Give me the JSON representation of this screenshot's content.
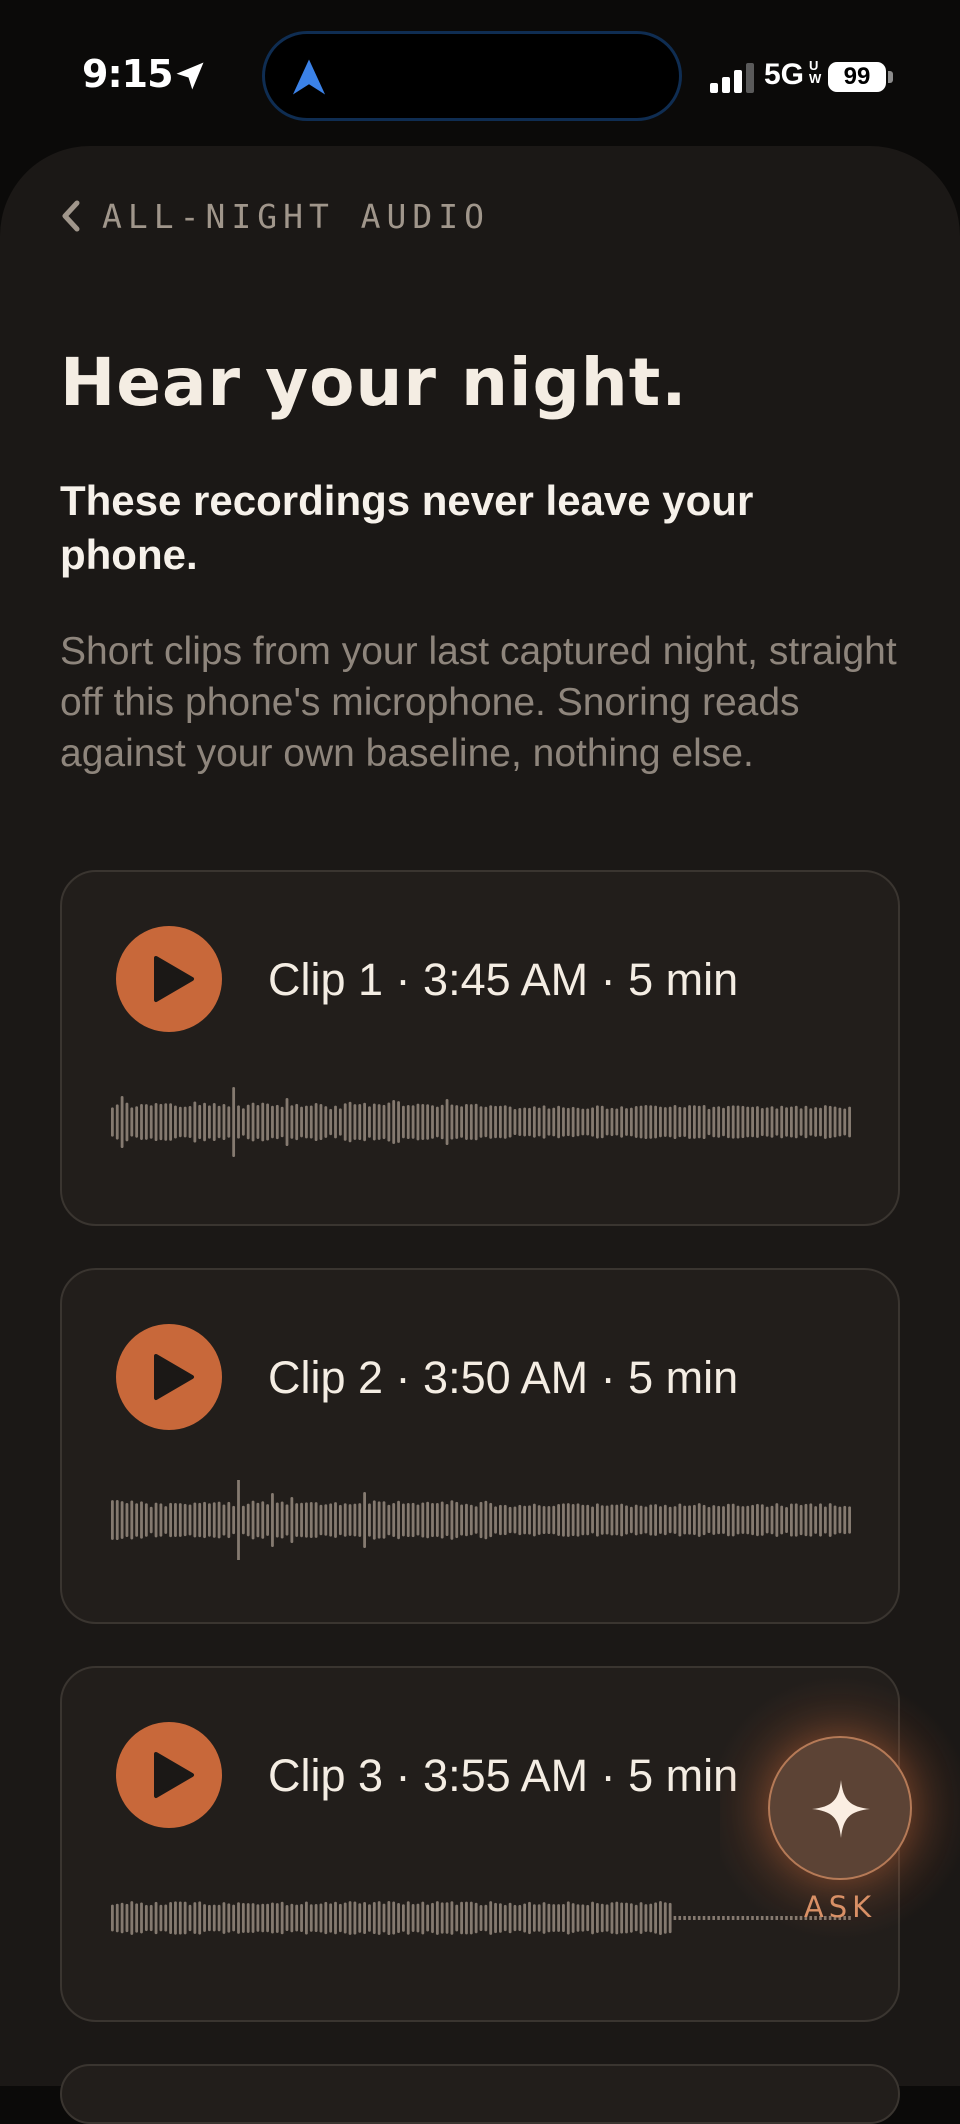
{
  "status_bar": {
    "time": "9:15",
    "network": "5G",
    "network_superscript": "UW",
    "battery": "99"
  },
  "nav": {
    "back_label": "ALL-NIGHT AUDIO"
  },
  "header": {
    "title": "Hear your night.",
    "subtitle": "These recordings never leave your phone.",
    "description": "Short clips from your last captured night, straight off this phone's microphone. Snoring reads against your own baseline, nothing else."
  },
  "clips": [
    {
      "label": "Clip 1 · 3:45 AM · 5 min"
    },
    {
      "label": "Clip 2 · 3:50 AM · 5 min"
    },
    {
      "label": "Clip 3 · 3:55 AM · 5 min"
    }
  ],
  "ask": {
    "label": "ASK"
  },
  "colors": {
    "accent": "#c8683a",
    "sheet": "#1b1816",
    "card": "#221e1b",
    "waveform": "#857a70"
  },
  "icons": {
    "back": "chevron-left-icon",
    "play": "play-icon",
    "ask": "sparkle-icon",
    "location": "location-arrow-icon",
    "signal": "signal-bars-icon"
  }
}
